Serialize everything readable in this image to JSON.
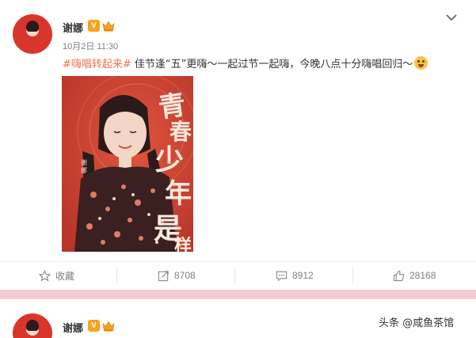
{
  "post": {
    "author": "谢娜",
    "verified_badge": "V",
    "time": "10月2日 11:30",
    "hashtag": "#嗨唱转起来#",
    "text": " 佳节逢“五”更嗨～一起过节一起嗨，今晚八点十分嗨唱回归～",
    "image_text": {
      "title_chars": "青春少年是样",
      "side_label": "谢娜"
    },
    "actions": {
      "favorite": "收藏",
      "forward": "8708",
      "comment": "8912",
      "like": "28168"
    }
  },
  "next_post": {
    "author": "谢娜",
    "verified_badge": "V"
  },
  "watermark": "头条 @咸鱼茶馆",
  "colors": {
    "hashtag": "#eb7350",
    "badge": "#f7a21b",
    "page_bg": "#f3cbd3",
    "poster_red": "#c94330"
  },
  "icons": [
    "crown-icon",
    "chevron-down-icon",
    "star-icon",
    "forward-icon",
    "comment-icon",
    "thumbs-up-icon"
  ]
}
